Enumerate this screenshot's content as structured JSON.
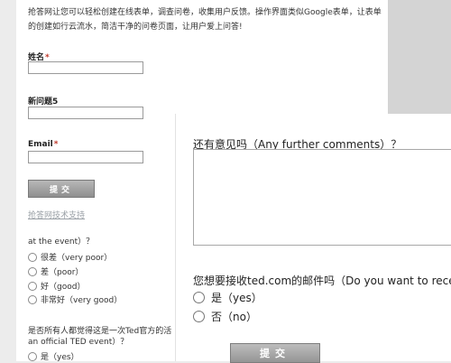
{
  "form_a": {
    "intro": "抢答网让您可以轻松创建在线表单，调查问卷，收集用户反馈。操作界面类似Google表单，让表单的创建如行云流水，简洁干净的问卷页面，让用户爱上问答!",
    "name_label": "姓名",
    "question5_label": "新问题5",
    "email_label": "Email",
    "required_mark": "*",
    "name_value": "",
    "question5_value": "",
    "email_value": "",
    "submit_label": "提交",
    "support_link": "抢答网技术支持"
  },
  "form_c": {
    "partial_question": "at the event）？",
    "options": [
      "很差（very poor）",
      "差（poor）",
      "好（good）",
      "非常好（very good）"
    ],
    "question2_line1": "是否所有人都觉得这是一次Ted官方的活",
    "question2_line2": "an official TED event）？",
    "yes_option": "是（yes）"
  },
  "form_b": {
    "comments_question": "还有意见吗（Any further comments）？",
    "comments_value": "",
    "email_question": "您想要接收ted.com的邮件吗（Do you want to receive",
    "yes_option": "是（yes）",
    "no_option": "否（no）",
    "submit_label": "提交"
  }
}
